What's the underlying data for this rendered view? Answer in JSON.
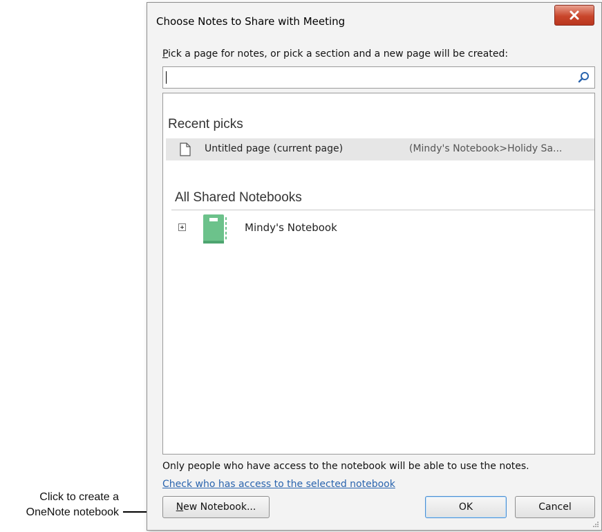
{
  "callout": {
    "line1": "Click to create a",
    "line2": "OneNote notebook"
  },
  "dialog": {
    "title": "Choose Notes to Share with Meeting",
    "prompt_mnemonic": "P",
    "prompt_rest": "ick a page for notes, or pick a section and a new page will be created:",
    "search": {
      "value": "",
      "icon": "search-icon"
    },
    "recent": {
      "header": "Recent picks",
      "items": [
        {
          "title": "Untitled page (current page)",
          "path": "(Mindy's Notebook>Holidy Sa..."
        }
      ]
    },
    "shared": {
      "header": "All Shared Notebooks",
      "notebooks": [
        {
          "name": "Mindy's Notebook",
          "color": "#6cc28b"
        }
      ]
    },
    "access_note": "Only people who have access to the notebook will be able to use the notes.",
    "access_link": "Check who has access to the selected notebook",
    "buttons": {
      "new_mnemonic": "N",
      "new_rest": "ew Notebook...",
      "ok": "OK",
      "cancel": "Cancel"
    }
  }
}
